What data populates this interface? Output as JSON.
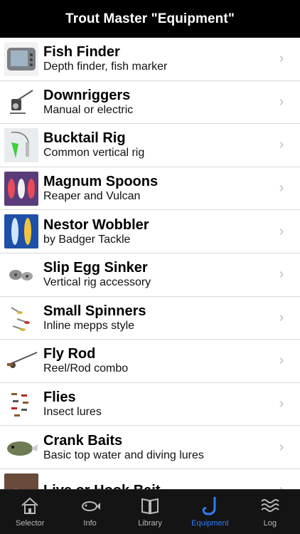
{
  "header": {
    "title": "Trout Master \"Equipment\""
  },
  "items": [
    {
      "title": "Fish Finder",
      "subtitle": "Depth finder, fish marker",
      "icon": "fish-finder-icon"
    },
    {
      "title": "Downriggers",
      "subtitle": "Manual or electric",
      "icon": "downrigger-icon"
    },
    {
      "title": "Bucktail Rig",
      "subtitle": "Common vertical rig",
      "icon": "bucktail-rig-icon"
    },
    {
      "title": "Magnum Spoons",
      "subtitle": "Reaper and Vulcan",
      "icon": "magnum-spoons-icon"
    },
    {
      "title": "Nestor Wobbler",
      "subtitle": "by Badger Tackle",
      "icon": "nestor-wobbler-icon"
    },
    {
      "title": "Slip Egg Sinker",
      "subtitle": "Vertical rig accessory",
      "icon": "egg-sinker-icon"
    },
    {
      "title": "Small Spinners",
      "subtitle": "Inline mepps style",
      "icon": "spinners-icon"
    },
    {
      "title": "Fly Rod",
      "subtitle": "Reel/Rod combo",
      "icon": "fly-rod-icon"
    },
    {
      "title": "Flies",
      "subtitle": "Insect lures",
      "icon": "flies-icon"
    },
    {
      "title": "Crank Baits",
      "subtitle": "Basic top water and diving lures",
      "icon": "crank-bait-icon"
    },
    {
      "title": "Live or Hook Bait",
      "subtitle": "",
      "icon": "live-bait-icon"
    }
  ],
  "tabs": [
    {
      "label": "Selector",
      "icon": "house-icon",
      "active": false
    },
    {
      "label": "Info",
      "icon": "fish-info-icon",
      "active": false
    },
    {
      "label": "Library",
      "icon": "book-icon",
      "active": false
    },
    {
      "label": "Equipment",
      "icon": "fishing-hook-icon",
      "active": true
    },
    {
      "label": "Log",
      "icon": "waves-icon",
      "active": false
    }
  ],
  "colors": {
    "accent": "#2f7cf6",
    "bar": "#000000",
    "tabbar": "#141414",
    "chevron": "#bdbdbd"
  }
}
